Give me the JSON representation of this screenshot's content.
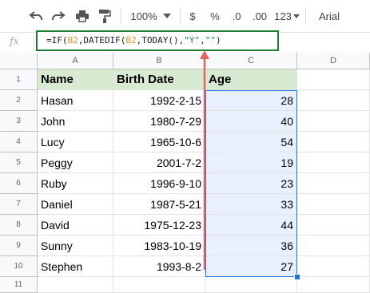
{
  "toolbar": {
    "zoom": "100%",
    "currency": "$",
    "percent": "%",
    "decrease_decimal": ".0",
    "increase_decimal": ".00",
    "more_formats": "123",
    "font": "Arial",
    "icons": [
      "undo-icon",
      "redo-icon",
      "print-icon",
      "paint-format-icon",
      "chevron-down-icon"
    ]
  },
  "formula_bar": {
    "fx_label": "fx",
    "parts": [
      "=IF(",
      "B2",
      ",DATEDIF(",
      "B2",
      ",TODAY(),",
      "\"Y\"",
      ",",
      "\"\"",
      ")"
    ]
  },
  "columns": [
    "A",
    "B",
    "C",
    "D"
  ],
  "rows": [
    "1",
    "2",
    "3",
    "4",
    "5",
    "6",
    "7",
    "8",
    "9",
    "10",
    "11"
  ],
  "table": {
    "headers": [
      "Name",
      "Birth Date",
      "Age"
    ],
    "data": [
      [
        "Hasan",
        "1992-2-15",
        "28"
      ],
      [
        "John",
        "1980-7-29",
        "40"
      ],
      [
        "Lucy",
        "1965-10-6",
        "54"
      ],
      [
        "Peggy",
        "2001-7-2",
        "19"
      ],
      [
        "Ruby",
        "1996-9-10",
        "23"
      ],
      [
        "Daniel",
        "1987-5-21",
        "33"
      ],
      [
        "David",
        "1975-12-23",
        "44"
      ],
      [
        "Sunny",
        "1983-10-19",
        "36"
      ],
      [
        "Stephen",
        "1993-8-2",
        "27"
      ]
    ]
  },
  "colors": {
    "header_fill": "#d9ead3",
    "selection": "#1a73e8",
    "formula_border": "#1e7e34",
    "arrow": "#e06666"
  }
}
